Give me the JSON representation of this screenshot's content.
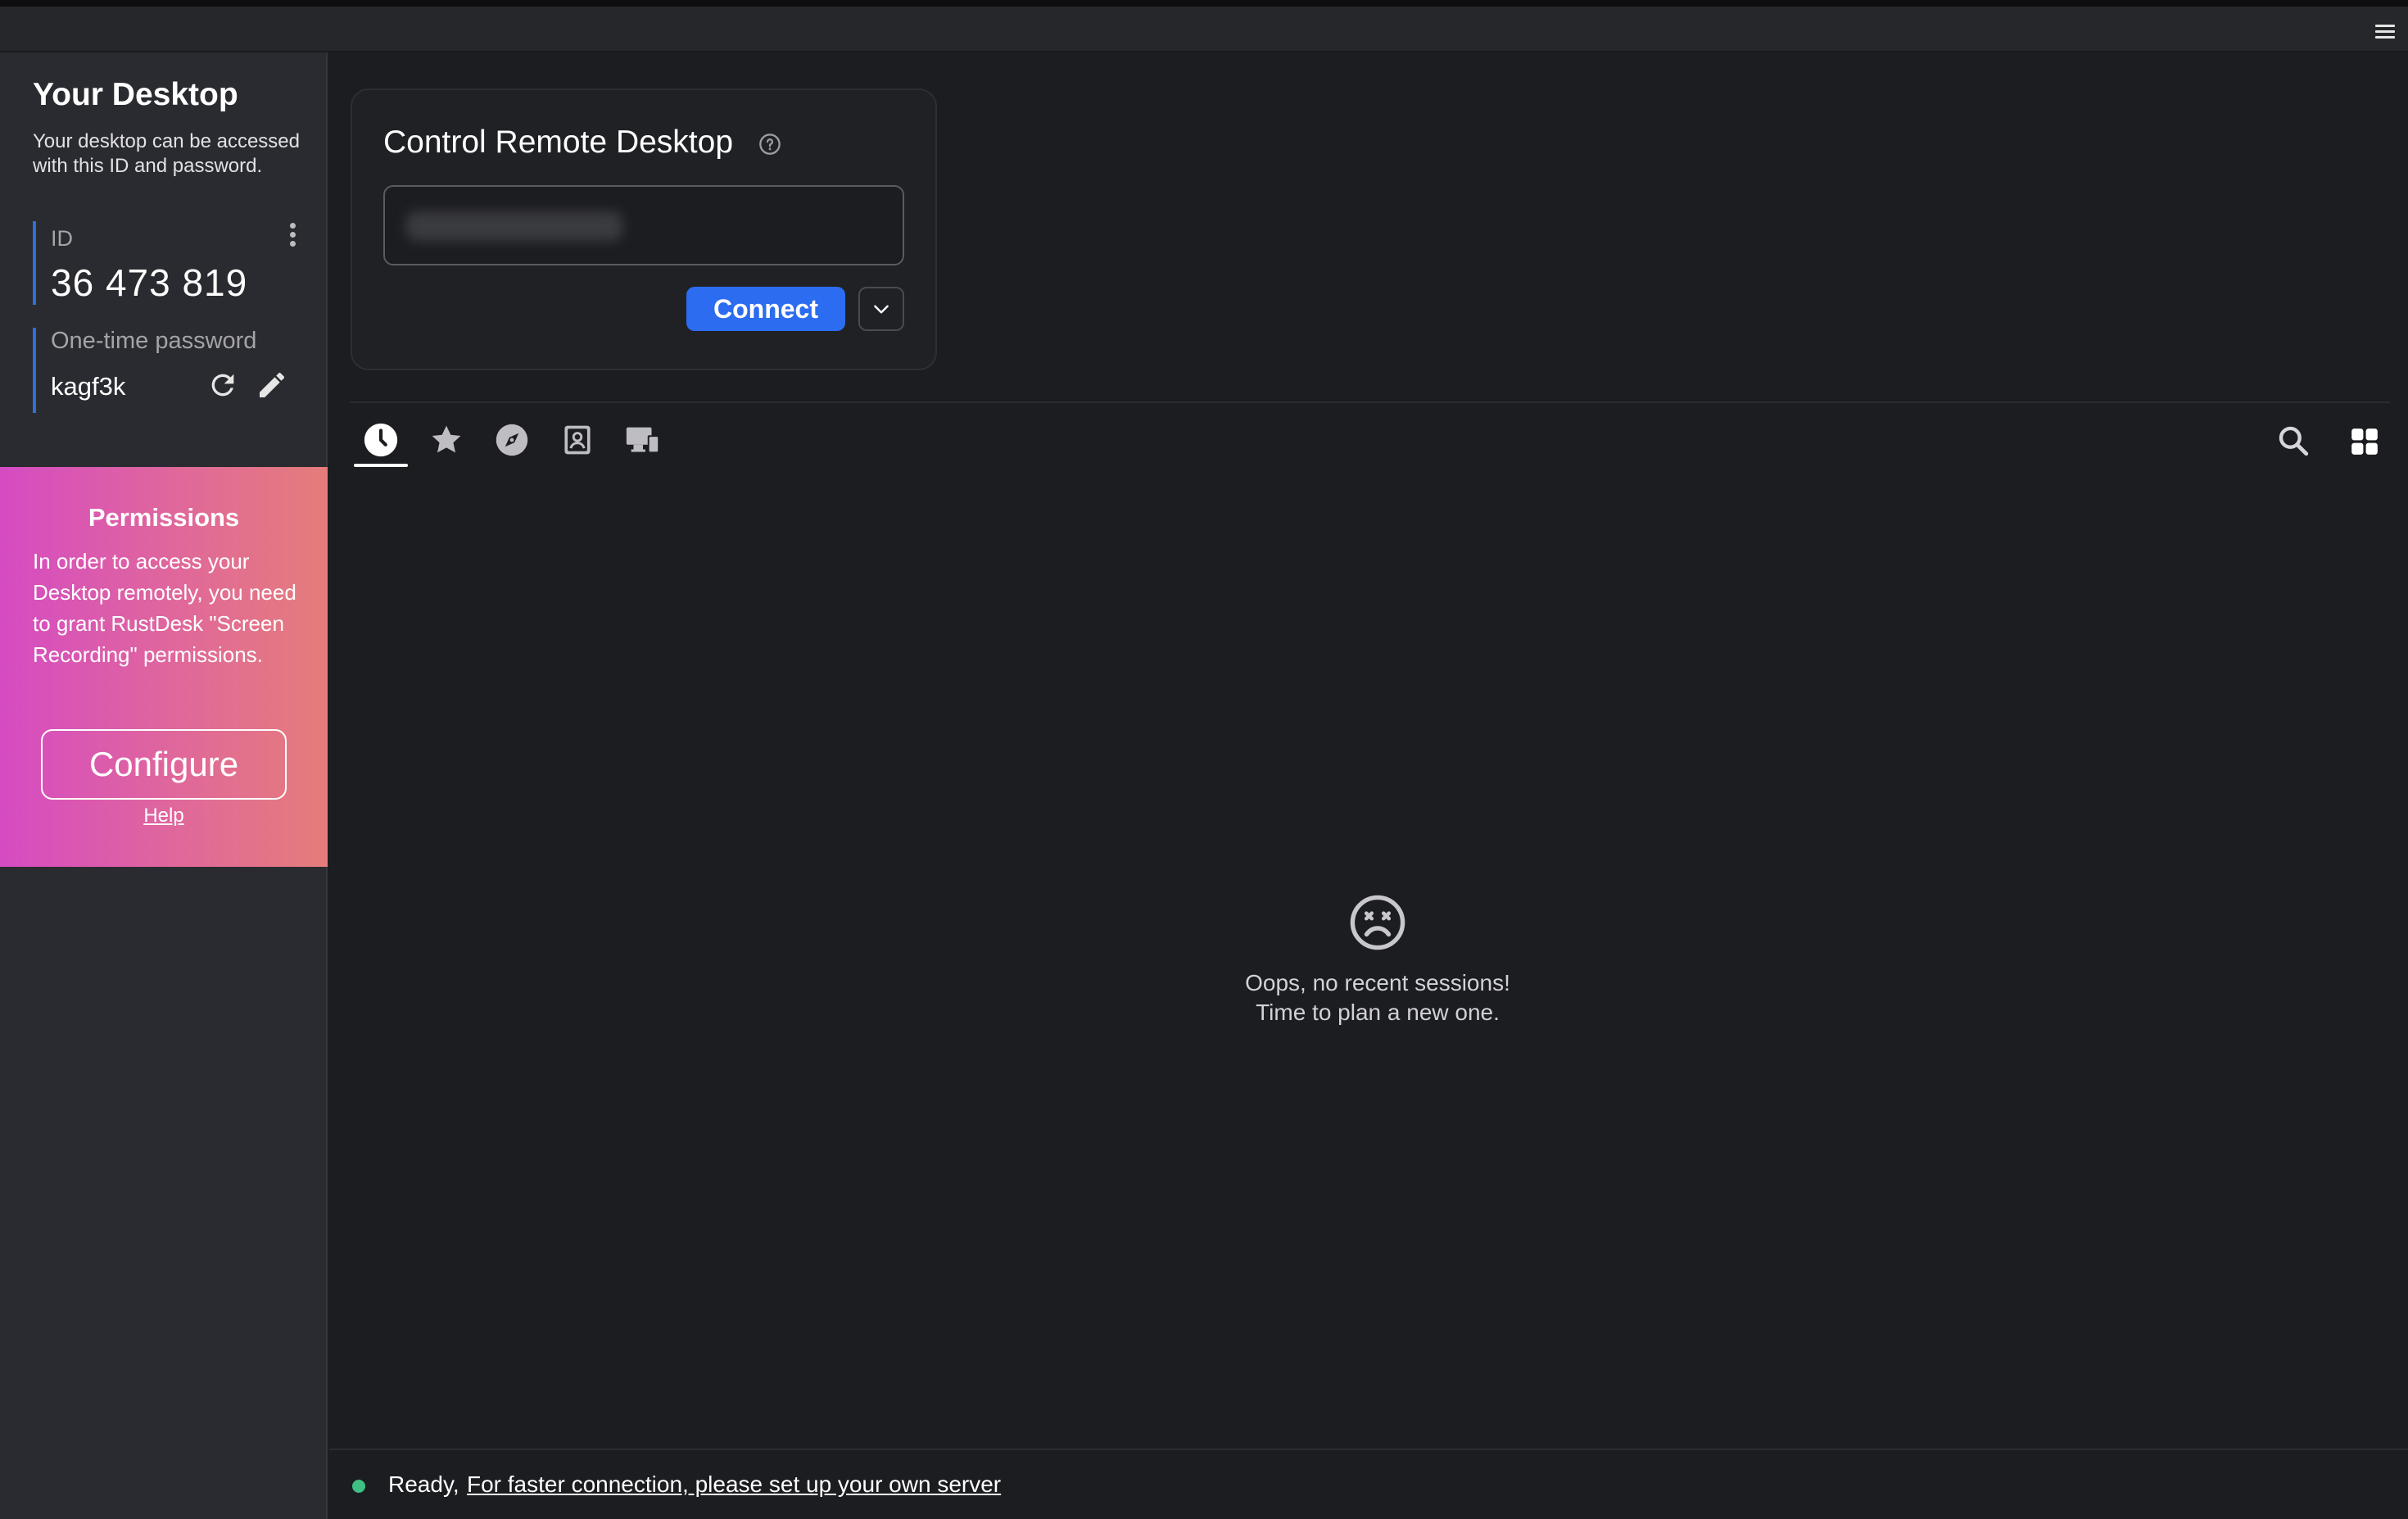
{
  "topbar": {
    "menu_icon": "hamburger-menu-icon"
  },
  "sidebar": {
    "title": "Your Desktop",
    "description": "Your desktop can be accessed with this ID and password.",
    "id_label": "ID",
    "id_value": "36 473 819",
    "password_label": "One-time password",
    "password_value": "kagf3k",
    "icons": [
      "more-vertical-icon",
      "refresh-icon",
      "edit-pencil-icon"
    ]
  },
  "permissions": {
    "title": "Permissions",
    "text": "In order to access your Desktop remotely, you need to grant RustDesk \"Screen Recording\" permissions.",
    "configure_label": "Configure",
    "help_label": "Help",
    "gradient_colors": [
      "#d54bc3",
      "#e57d7a"
    ]
  },
  "control": {
    "title": "Control Remote Desktop",
    "help_icon": "help-circle-icon",
    "input_value": "",
    "connect_label": "Connect",
    "dropdown_icon": "chevron-down-icon",
    "accent": "#2c6cf0"
  },
  "tabs": [
    {
      "name": "recent-sessions",
      "icon": "clock-icon",
      "active": true
    },
    {
      "name": "favorites",
      "icon": "star-icon",
      "active": false
    },
    {
      "name": "discovered",
      "icon": "compass-icon",
      "active": false
    },
    {
      "name": "address-book",
      "icon": "contact-card-icon",
      "active": false
    },
    {
      "name": "devices",
      "icon": "devices-icon",
      "active": false
    }
  ],
  "toolbar_right": [
    "search-icon",
    "grid-view-icon"
  ],
  "empty_state": {
    "icon": "sad-face-icon",
    "line1": "Oops, no recent sessions!",
    "line2": "Time to plan a new one."
  },
  "status": {
    "ready": "Ready,",
    "link": "For faster connection, please set up your own server",
    "dot_color": "#3fbf83"
  }
}
